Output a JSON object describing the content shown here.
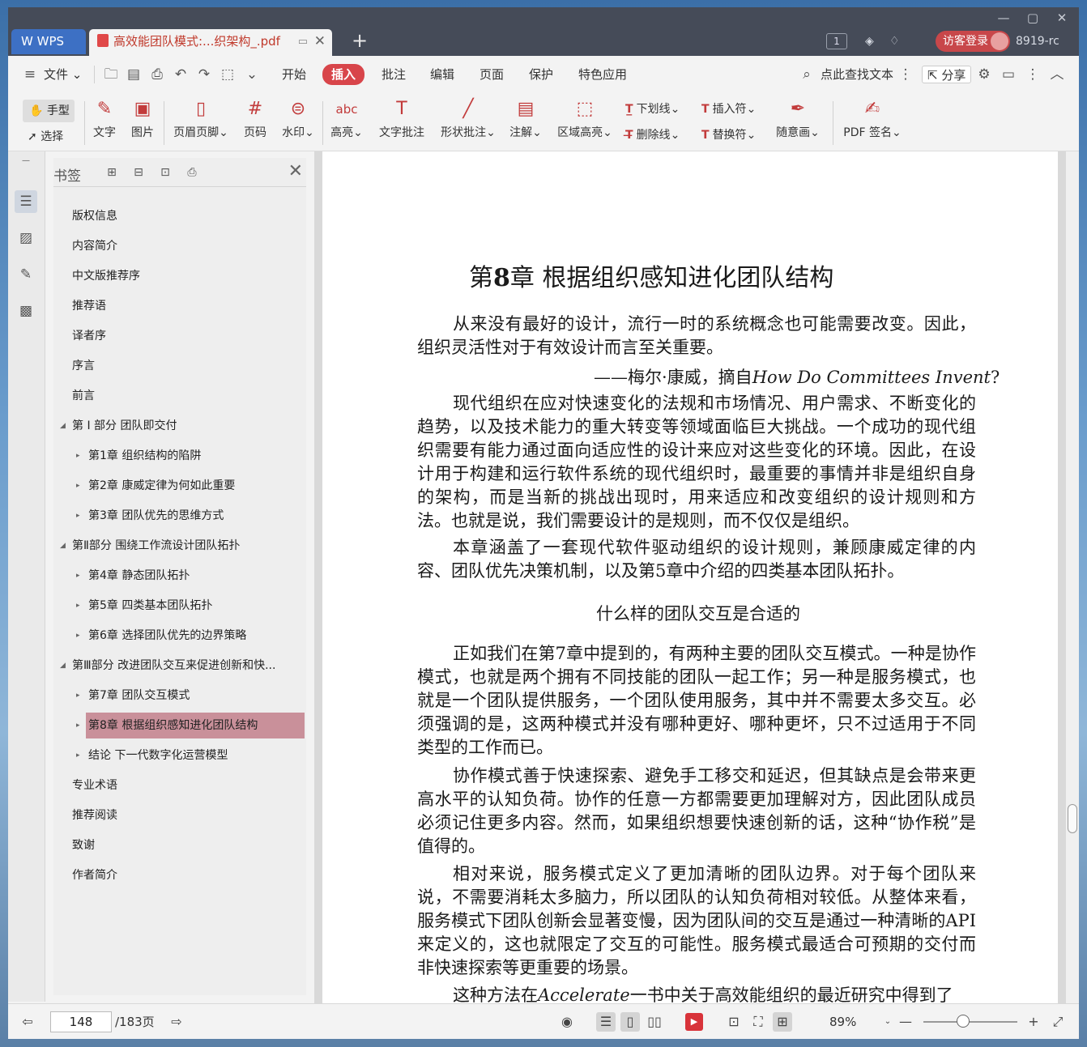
{
  "window": {
    "wps_tab": "WPS",
    "doc_tab_title": "高效能团队模式:...织架构_.pdf",
    "badge": "1",
    "login": "访客登录",
    "user_id": "8919-rc"
  },
  "menu": {
    "file": "文件",
    "tabs": [
      "开始",
      "插入",
      "批注",
      "编辑",
      "页面",
      "保护",
      "特色应用"
    ],
    "active_tab": "插入",
    "search": "点此查找文本",
    "share": "分享"
  },
  "ribbon": {
    "hand": "手型",
    "select": "选择",
    "text": "文字",
    "image": "图片",
    "header_footer": "页眉页脚",
    "page_num": "页码",
    "watermark": "水印",
    "highlight": "高亮",
    "text_comment": "文字批注",
    "shape_comment": "形状批注",
    "annotation": "注解",
    "area_highlight": "区域高亮",
    "underline": "下划线",
    "strikethrough": "删除线",
    "insert_mark": "插入符",
    "replace_mark": "替换符",
    "freehand": "随意画",
    "pdf_sign": "PDF 签名"
  },
  "bookmarks": {
    "title": "书签",
    "items": [
      "版权信息",
      "内容简介",
      "中文版推荐序",
      "推荐语",
      "译者序",
      "序言",
      "前言",
      "第 I 部分 团队即交付",
      "第1章 组织结构的陷阱",
      "第2章 康威定律为何如此重要",
      "第3章 团队优先的思维方式",
      "第Ⅱ部分 围绕工作流设计团队拓扑",
      "第4章 静态团队拓扑",
      "第5章 四类基本团队拓扑",
      "第6章 选择团队优先的边界策略",
      "第Ⅲ部分 改进团队交互来促进创新和快...",
      "第7章 团队交互模式",
      "第8章 根据组织感知进化团队结构",
      "结论 下一代数字化运营模型",
      "专业术语",
      "推荐阅读",
      "致谢",
      "作者简介"
    ]
  },
  "document": {
    "chapter_prefix": "第",
    "chapter_num": "8",
    "chapter_title": "章 根据组织感知进化团队结构",
    "p1": "从来没有最好的设计，流行一时的系统概念也可能需要改变。因此，组织灵活性对于有效设计而言至关重要。",
    "quote_prefix": "——梅尔·康威，摘自",
    "quote_italic": "How Do Committees Invent",
    "quote_suffix": "?",
    "p2": "现代组织在应对快速变化的法规和市场情况、用户需求、不断变化的趋势，以及技术能力的重大转变等领域面临巨大挑战。一个成功的现代组织需要有能力通过面向适应性的设计来应对这些变化的环境。因此，在设计用于构建和运行软件系统的现代组织时，最重要的事情并非是组织自身的架构，而是当新的挑战出现时，用来适应和改变组织的设计规则和方法。也就是说，我们需要设计的是规则，而不仅仅是组织。",
    "p3": "本章涵盖了一套现代软件驱动组织的设计规则，兼顾康威定律的内容、团队优先决策机制，以及第5章中介绍的四类基本团队拓扑。",
    "section": "什么样的团队交互是合适的",
    "p4": "正如我们在第7章中提到的，有两种主要的团队交互模式。一种是协作模式，也就是两个拥有不同技能的团队一起工作；另一种是服务模式，也就是一个团队提供服务，一个团队使用服务，其中并不需要太多交互。必须强调的是，这两种模式并没有哪种更好、哪种更坏，只不过适用于不同类型的工作而已。",
    "p5": "协作模式善于快速探索、避免手工移交和延迟，但其缺点是会带来更高水平的认知负荷。协作的任意一方都需要更加理解对方，因此团队成员必须记住更多内容。然而，如果组织想要快速创新的话，这种“协作税”是值得的。",
    "p6": "相对来说，服务模式定义了更加清晰的团队边界。对于每个团队来说，不需要消耗太多脑力，所以团队的认知负荷相对较低。从整体来看，服务模式下团队创新会显著变慢，因为团队间的交互是通过一种清晰的API来定义的，这也就限定了交互的可能性。服务模式最适合可预期的交付而非快速探索等更重要的场景。",
    "p7_prefix": "这种方法在",
    "p7_italic": "Accelerate",
    "p7_suffix": "一书中关于高效能组织的最近研究中得到了"
  },
  "status": {
    "page": "148",
    "total": "/183页",
    "zoom": "89%"
  }
}
